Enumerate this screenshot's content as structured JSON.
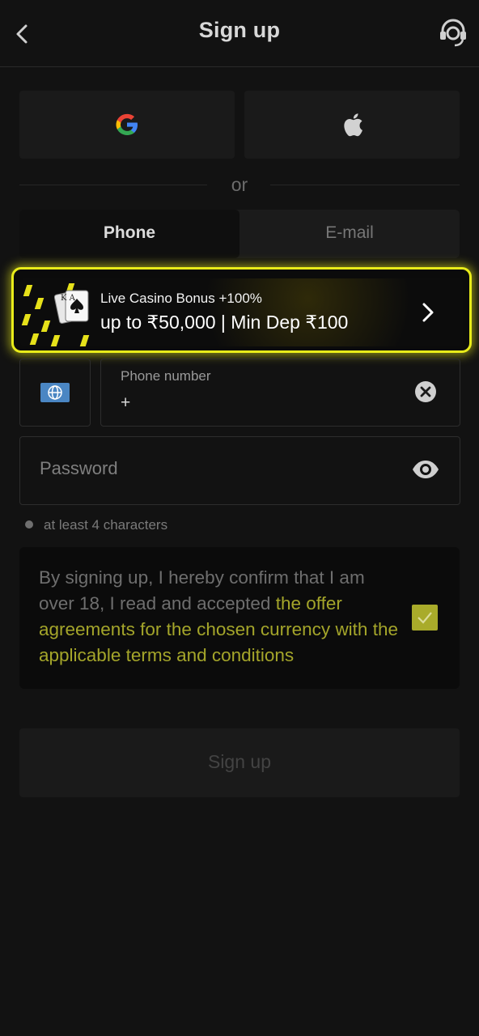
{
  "header": {
    "title": "Sign up"
  },
  "divider": {
    "text": "or"
  },
  "tabs": [
    {
      "label": "Phone"
    },
    {
      "label": "E-mail"
    }
  ],
  "banner": {
    "line1": "Live Casino Bonus +100%",
    "line2": "up to ₹50,000 | Min Dep ₹100",
    "card_letters": "K A"
  },
  "phone": {
    "label": "Phone number",
    "value": "+"
  },
  "password": {
    "placeholder": "Password"
  },
  "hint": {
    "text": "at least 4 characters"
  },
  "consent": {
    "text": "By signing up, I hereby confirm that I am over 18, I read and accepted ",
    "link": "the offer agreements for the chosen currency with the applicable terms and conditions",
    "checked": true
  },
  "submit": {
    "label": "Sign up"
  },
  "colors": {
    "accent": "#e9ec1a",
    "link": "#a4a52a",
    "background": "#121212"
  }
}
